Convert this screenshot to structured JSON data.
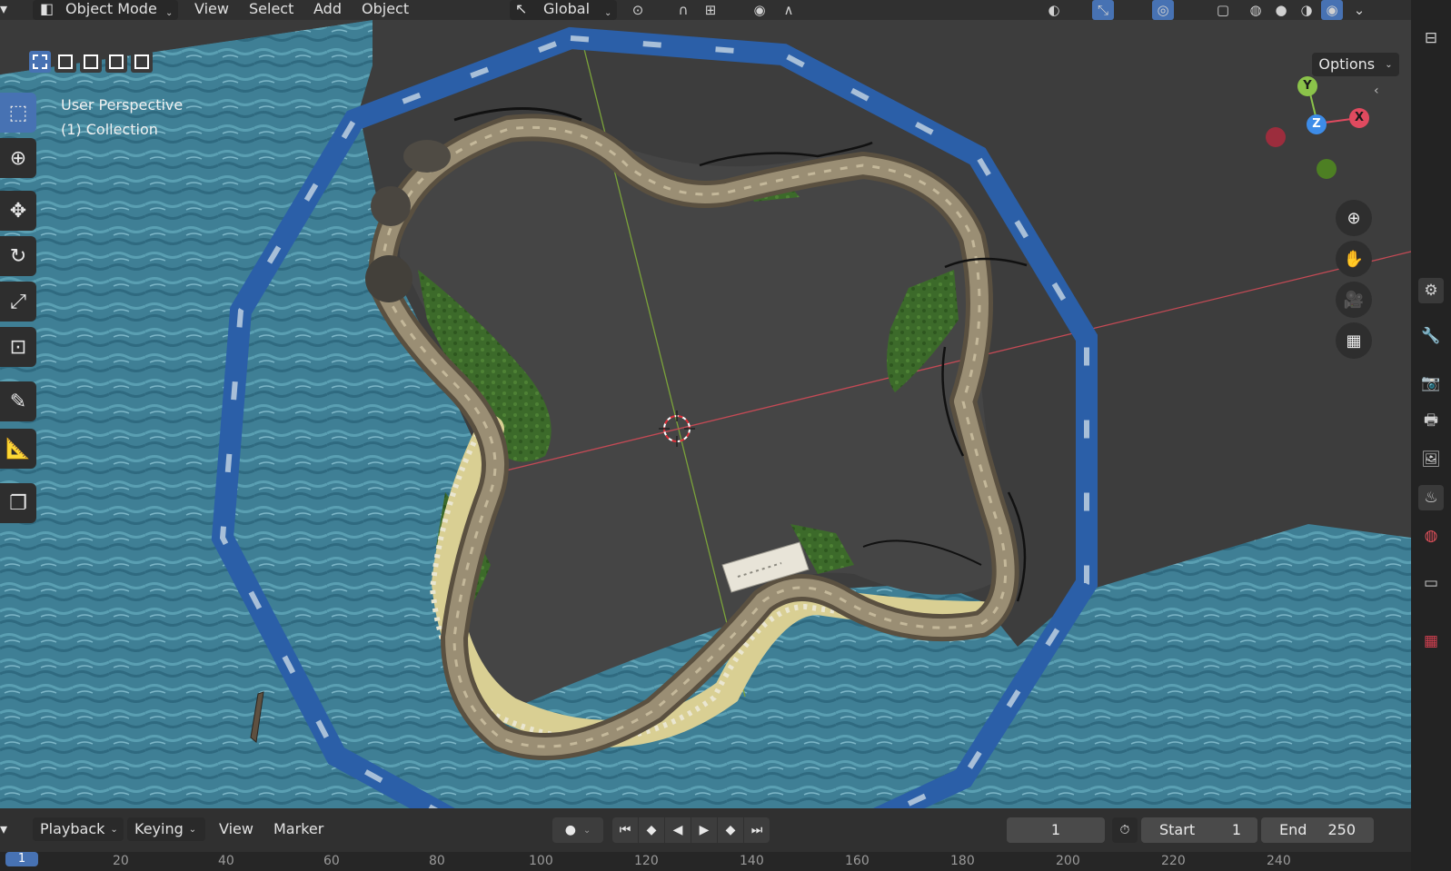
{
  "header": {
    "mode": "Object Mode",
    "menus": [
      "View",
      "Select",
      "Add",
      "Object"
    ],
    "transform_orientation": "Global",
    "icons": [
      "editor-type-icon",
      "object-mode-icon",
      "orientation-icon",
      "pivot-icon",
      "snap-icon",
      "snap-increment-icon",
      "proportional-edit-icon",
      "falloff-icon",
      "visibility-icon",
      "gizmo-icon",
      "overlay-icon",
      "xray-icon",
      "wireframe-shading-icon",
      "solid-shading-icon",
      "material-shading-icon",
      "rendered-shading-icon"
    ]
  },
  "viewport": {
    "perspective_label": "User Perspective",
    "collection_label": "(1) Collection",
    "options_label": "Options",
    "gizmo": {
      "x": "X",
      "y": "Y",
      "z": "Z"
    },
    "colors": {
      "x_axis": "#e04a5f",
      "y_axis": "#8bc34a",
      "z_axis": "#3d8ce8",
      "water": "#3f7f95",
      "rim_blue": "#2b5fa8",
      "road": "#8a7e66",
      "grass": "#3c6a2a"
    }
  },
  "toolbar": {
    "tools": [
      "select-box-icon",
      "cursor-icon",
      "move-icon",
      "rotate-icon",
      "scale-icon",
      "transform-icon",
      "annotate-icon",
      "measure-icon",
      "add-cube-icon"
    ]
  },
  "properties": {
    "tabs": [
      "outliner-icon",
      "tool-settings-icon",
      "tool-icon",
      "render-icon",
      "output-icon",
      "view-layer-icon",
      "scene-icon",
      "world-icon",
      "collection-icon",
      "texture-icon"
    ]
  },
  "timeline": {
    "menus": [
      "Playback",
      "Keying",
      "View",
      "Marker"
    ],
    "current_frame": "1",
    "start_label": "Start",
    "start_value": "1",
    "end_label": "End",
    "end_value": "250",
    "ruler_ticks": [
      "20",
      "40",
      "60",
      "80",
      "100",
      "120",
      "140",
      "160",
      "180",
      "200",
      "220",
      "240"
    ],
    "ruler_current": "1"
  }
}
